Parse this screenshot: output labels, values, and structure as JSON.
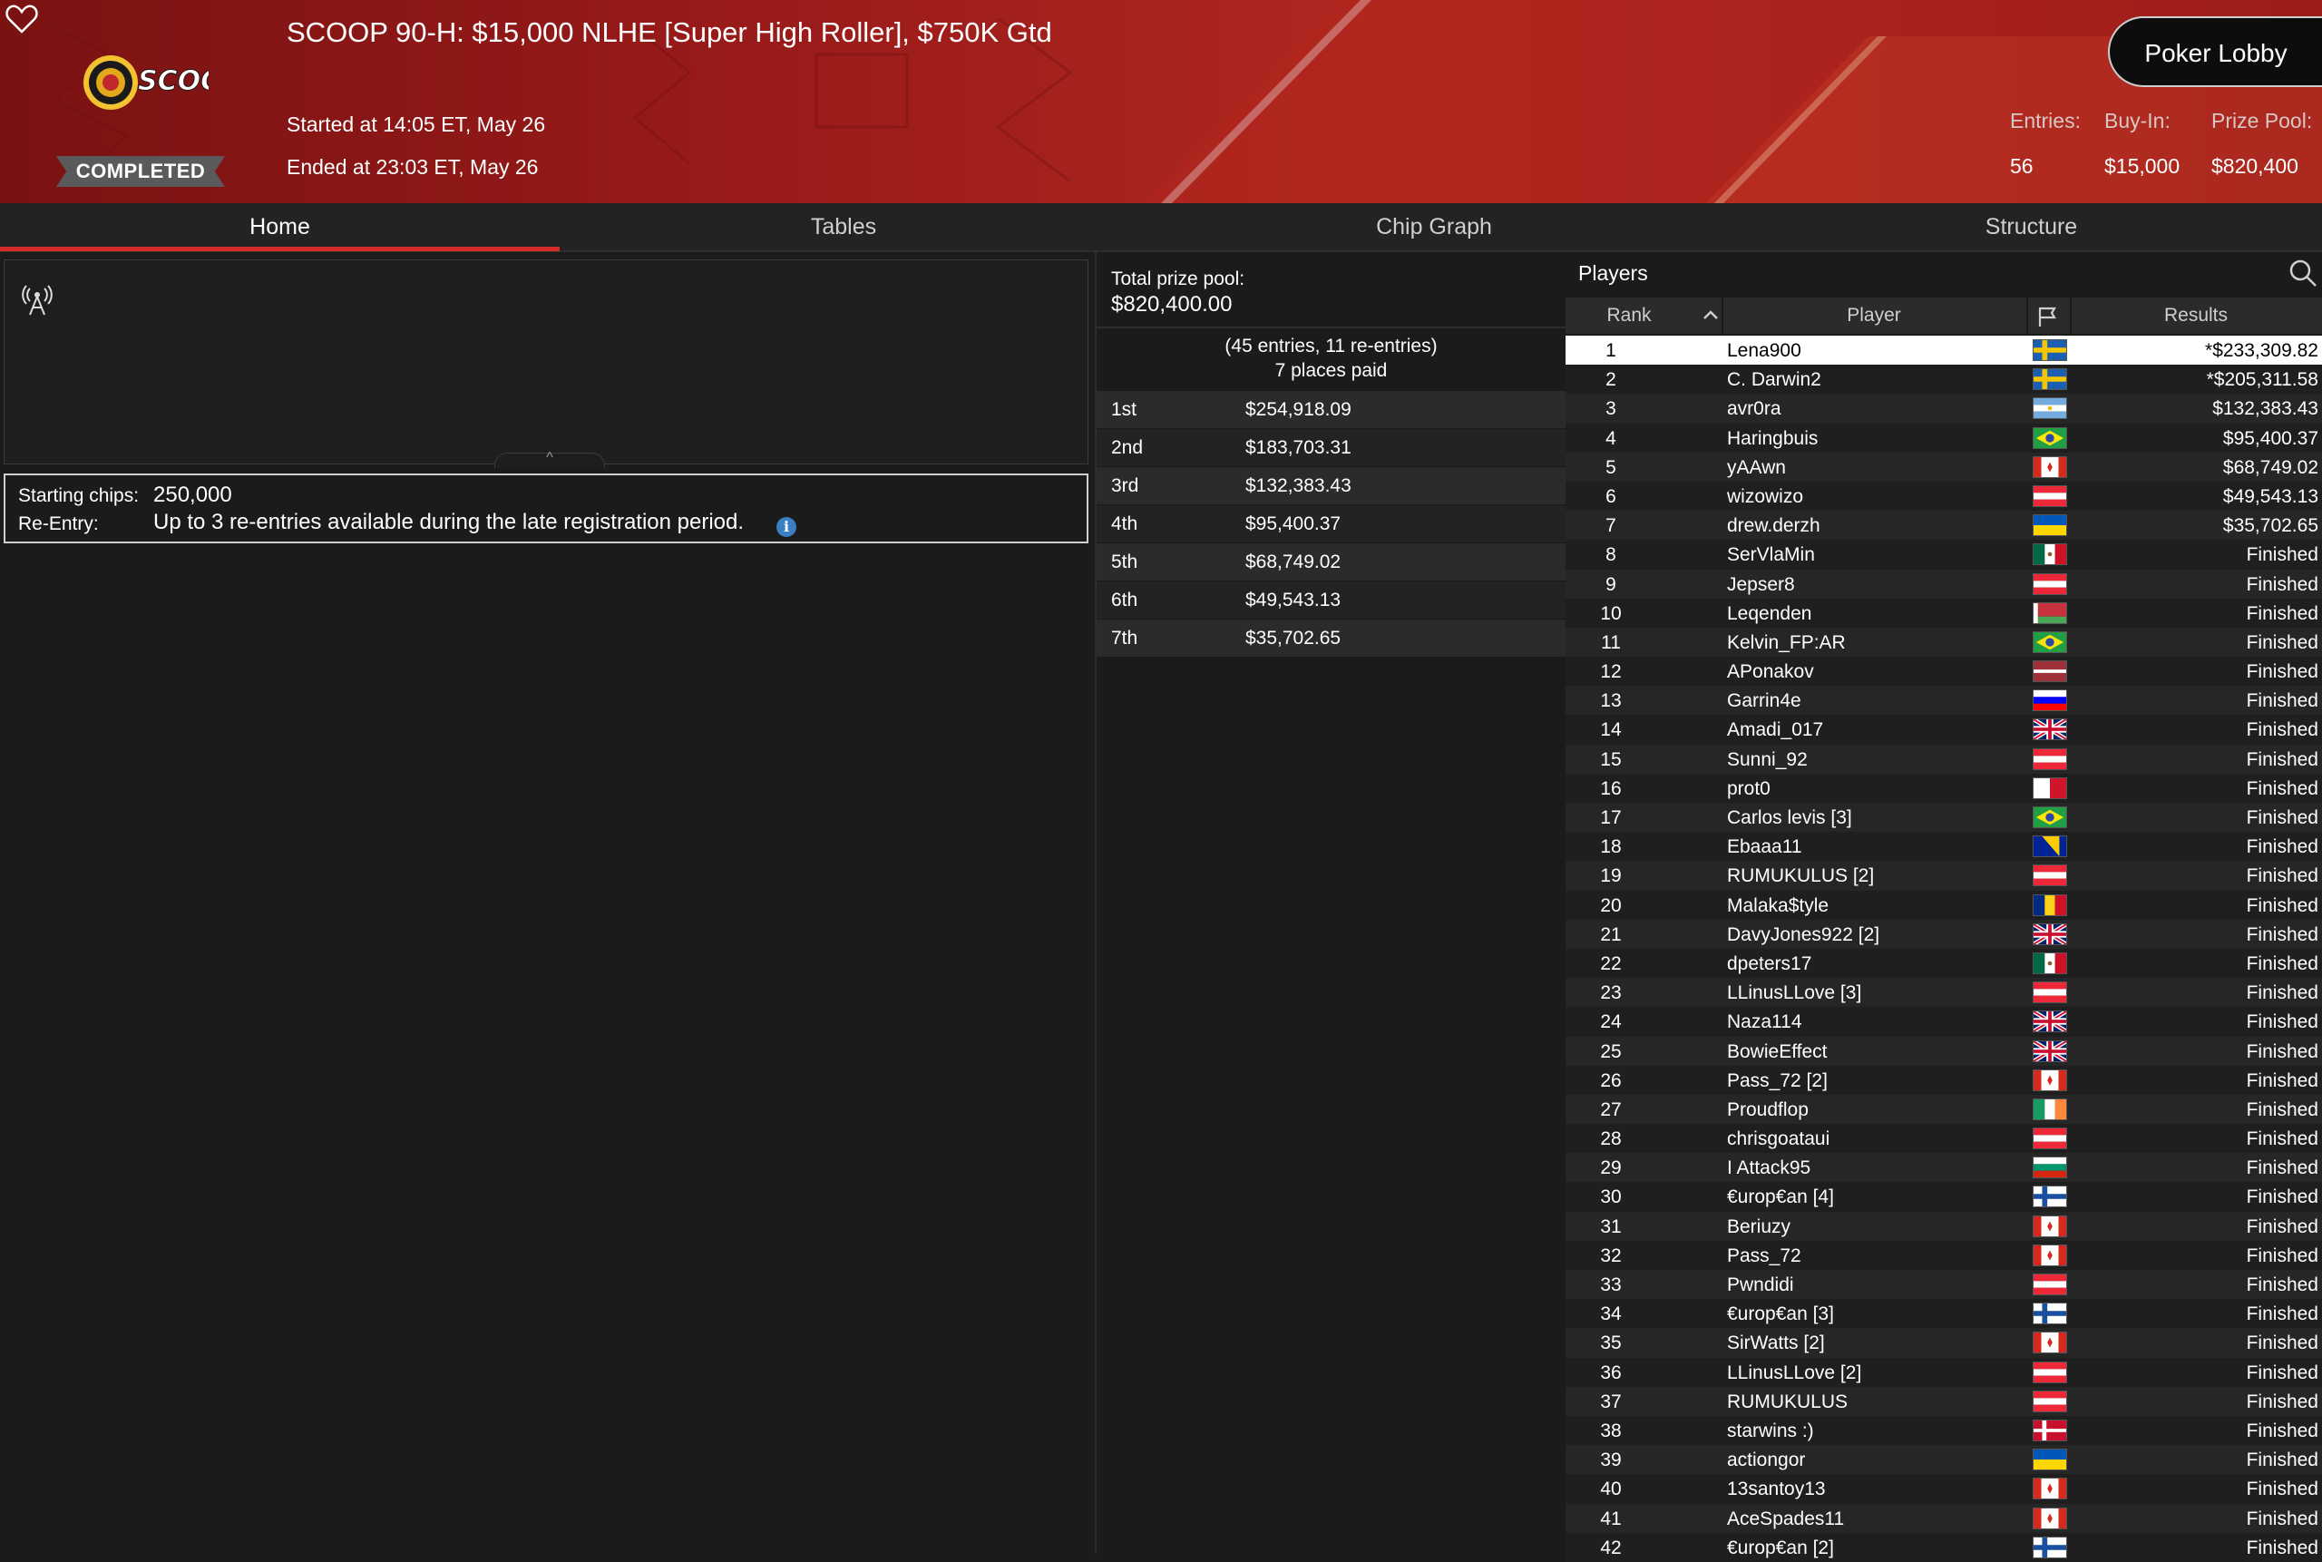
{
  "header": {
    "title": "SCOOP 90-H: $15,000 NLHE [Super High Roller], $750K Gtd",
    "logo_text": "SCOOP",
    "status": "COMPLETED",
    "started": "Started at 14:05 ET, May 26",
    "ended": "Ended at 23:03 ET, May 26",
    "lobby_button": "Poker Lobby",
    "stats": {
      "entries_label": "Entries:",
      "buyin_label": "Buy-In:",
      "prizepool_label": "Prize Pool:",
      "entries": "56",
      "buyin": "$15,000",
      "prizepool": "$820,400"
    }
  },
  "tabs": [
    "Home",
    "Tables",
    "Chip Graph",
    "Structure"
  ],
  "active_tab": "Home",
  "home": {
    "starting_chips_label": "Starting chips:",
    "starting_chips": "250,000",
    "reentry_label": "Re-Entry:",
    "reentry_text": "Up to 3 re-entries available during the late registration period.",
    "info_icon": "i"
  },
  "prizes": {
    "total_label": "Total prize pool:",
    "total": "$820,400.00",
    "entries_note": "(45 entries, 11 re-entries)",
    "places_note": "7 places paid",
    "payouts": [
      {
        "place": "1st",
        "amount": "$254,918.09"
      },
      {
        "place": "2nd",
        "amount": "$183,703.31"
      },
      {
        "place": "3rd",
        "amount": "$132,383.43"
      },
      {
        "place": "4th",
        "amount": "$95,400.37"
      },
      {
        "place": "5th",
        "amount": "$68,749.02"
      },
      {
        "place": "6th",
        "amount": "$49,543.13"
      },
      {
        "place": "7th",
        "amount": "$35,702.65"
      }
    ]
  },
  "players": {
    "title": "Players",
    "columns": {
      "rank": "Rank",
      "player": "Player",
      "results": "Results"
    },
    "rows": [
      {
        "rank": "1",
        "name": "Lena900",
        "flag": "sweden",
        "result": "*$233,309.82"
      },
      {
        "rank": "2",
        "name": "C. Darwin2",
        "flag": "sweden",
        "result": "*$205,311.58"
      },
      {
        "rank": "3",
        "name": "avr0ra",
        "flag": "argentina",
        "result": "$132,383.43"
      },
      {
        "rank": "4",
        "name": "Haringbuis",
        "flag": "brazil",
        "result": "$95,400.37"
      },
      {
        "rank": "5",
        "name": "yAAwn",
        "flag": "canada",
        "result": "$68,749.02"
      },
      {
        "rank": "6",
        "name": "wizowizo",
        "flag": "austria",
        "result": "$49,543.13"
      },
      {
        "rank": "7",
        "name": "drew.derzh",
        "flag": "ukraine",
        "result": "$35,702.65"
      },
      {
        "rank": "8",
        "name": "SerVlaMin",
        "flag": "mexico",
        "result": "Finished"
      },
      {
        "rank": "9",
        "name": "Jepser8",
        "flag": "austria",
        "result": "Finished"
      },
      {
        "rank": "10",
        "name": "Leqenden",
        "flag": "belarus",
        "result": "Finished"
      },
      {
        "rank": "11",
        "name": "Kelvin_FP:AR",
        "flag": "brazil",
        "result": "Finished"
      },
      {
        "rank": "12",
        "name": "APonakov",
        "flag": "latvia",
        "result": "Finished"
      },
      {
        "rank": "13",
        "name": "Garrin4e",
        "flag": "slovenia",
        "result": "Finished"
      },
      {
        "rank": "14",
        "name": "Amadi_017",
        "flag": "uk",
        "result": "Finished"
      },
      {
        "rank": "15",
        "name": "Sunni_92",
        "flag": "austria",
        "result": "Finished"
      },
      {
        "rank": "16",
        "name": "prot0",
        "flag": "malta",
        "result": "Finished"
      },
      {
        "rank": "17",
        "name": "Carlos levis [3]",
        "flag": "brazil",
        "result": "Finished"
      },
      {
        "rank": "18",
        "name": "Ebaaa11",
        "flag": "bosnia",
        "result": "Finished"
      },
      {
        "rank": "19",
        "name": "RUMUKULUS [2]",
        "flag": "austria",
        "result": "Finished"
      },
      {
        "rank": "20",
        "name": "Malaka$tyle",
        "flag": "romania",
        "result": "Finished"
      },
      {
        "rank": "21",
        "name": "DavyJones922 [2]",
        "flag": "uk",
        "result": "Finished"
      },
      {
        "rank": "22",
        "name": "dpeters17",
        "flag": "mexico",
        "result": "Finished"
      },
      {
        "rank": "23",
        "name": "LLinusLLove [3]",
        "flag": "austria",
        "result": "Finished"
      },
      {
        "rank": "24",
        "name": "Naza114",
        "flag": "uk",
        "result": "Finished"
      },
      {
        "rank": "25",
        "name": "BowieEffect",
        "flag": "uk",
        "result": "Finished"
      },
      {
        "rank": "26",
        "name": "Pass_72 [2]",
        "flag": "canada",
        "result": "Finished"
      },
      {
        "rank": "27",
        "name": "Proudflop",
        "flag": "ireland",
        "result": "Finished"
      },
      {
        "rank": "28",
        "name": "chrisgoataui",
        "flag": "austria",
        "result": "Finished"
      },
      {
        "rank": "29",
        "name": "I Attack95",
        "flag": "bulgaria",
        "result": "Finished"
      },
      {
        "rank": "30",
        "name": "€urop€an [4]",
        "flag": "finland",
        "result": "Finished"
      },
      {
        "rank": "31",
        "name": "Beriuzy",
        "flag": "canada",
        "result": "Finished"
      },
      {
        "rank": "32",
        "name": "Pass_72",
        "flag": "canada",
        "result": "Finished"
      },
      {
        "rank": "33",
        "name": "Pwndidi",
        "flag": "austria",
        "result": "Finished"
      },
      {
        "rank": "34",
        "name": "€urop€an [3]",
        "flag": "finland",
        "result": "Finished"
      },
      {
        "rank": "35",
        "name": "SirWatts [2]",
        "flag": "canada",
        "result": "Finished"
      },
      {
        "rank": "36",
        "name": "LLinusLLove [2]",
        "flag": "austria",
        "result": "Finished"
      },
      {
        "rank": "37",
        "name": "RUMUKULUS",
        "flag": "austria",
        "result": "Finished"
      },
      {
        "rank": "38",
        "name": "starwins :)",
        "flag": "denmark",
        "result": "Finished"
      },
      {
        "rank": "39",
        "name": "actiongor",
        "flag": "ukraine",
        "result": "Finished"
      },
      {
        "rank": "40",
        "name": "13santoy13",
        "flag": "canada",
        "result": "Finished"
      },
      {
        "rank": "41",
        "name": "AceSpades11",
        "flag": "canada",
        "result": "Finished"
      },
      {
        "rank": "42",
        "name": "€urop€an [2]",
        "flag": "finland",
        "result": "Finished"
      }
    ]
  },
  "colors": {
    "header_red": "#9b1c1a",
    "accent_red": "#d72b2b",
    "panel_bg": "#1b1b1b",
    "row_alt": "#262626",
    "highlight_row": "#ffffff",
    "info_blue": "#3a7fc4"
  }
}
